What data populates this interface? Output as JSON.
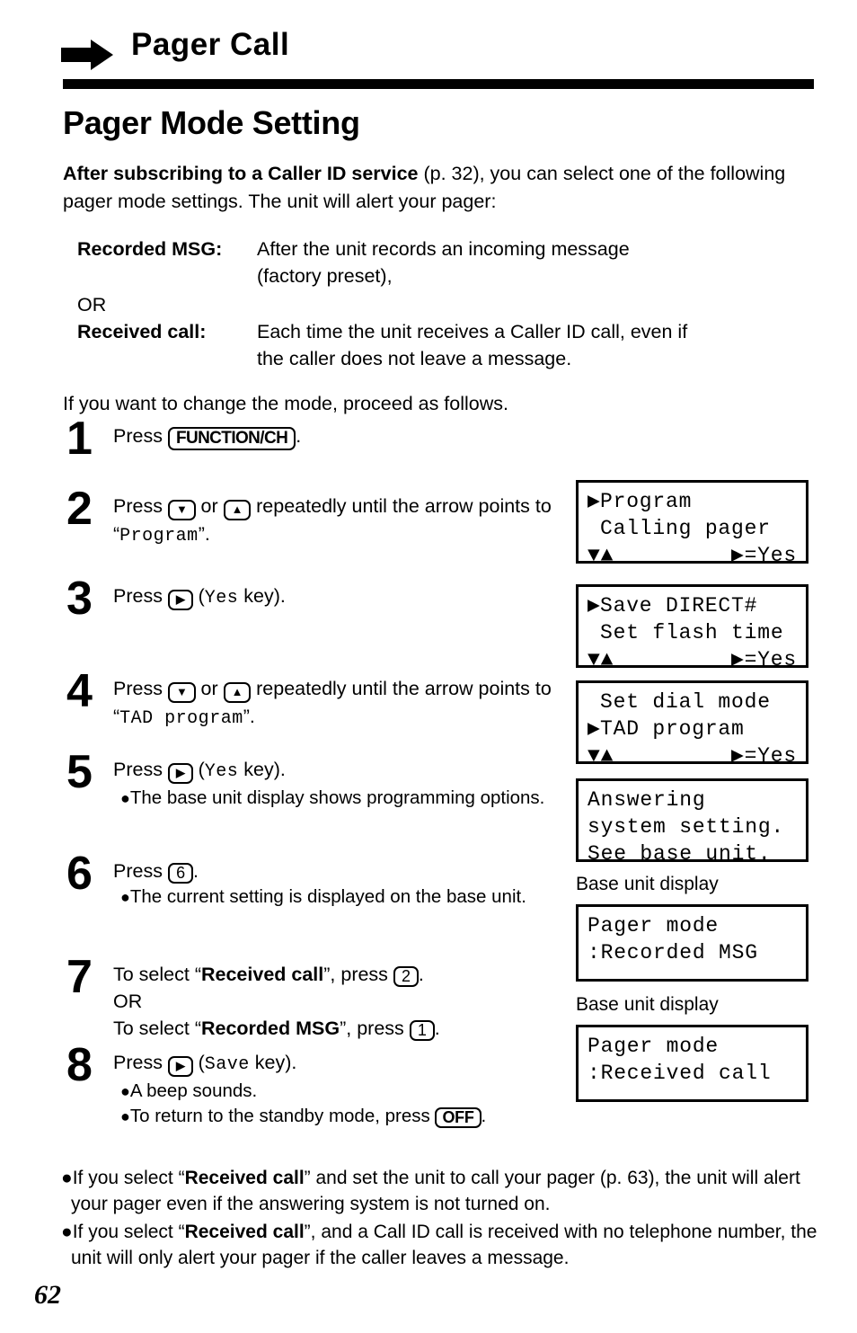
{
  "header": {
    "arrow_icon": "right-arrow-icon",
    "title": "Pager Call"
  },
  "section": {
    "title": "Pager Mode Setting",
    "intro_bold": "After subscribing to a Caller ID service",
    "intro_rest": " (p. 32), you can select one of the following pager mode settings. The unit will alert your pager:",
    "lead_in": "If you want to change the mode, proceed as follows."
  },
  "definitions": [
    {
      "term": "Recorded MSG:",
      "desc_line1": "After the unit records an incoming message",
      "desc_line2": "(factory preset),"
    },
    {
      "separator": "OR"
    },
    {
      "term": "Received call:",
      "desc_line1": "Each time the unit receives a Caller ID call, even if",
      "desc_line2": "the caller does not leave a message."
    }
  ],
  "steps": [
    {
      "number": "1",
      "press_label": "Press ",
      "key": "FUNCTION/CH",
      "tail": "."
    },
    {
      "number": "2",
      "press_label": "Press ",
      "key_down": "▼",
      "or_label": " or ",
      "key_up": "▲",
      "text_after": " repeatedly until the arrow points to “",
      "mono_value": "Program",
      "text_end": "”."
    },
    {
      "number": "3",
      "press_label": "Press ",
      "key_right": "▶",
      "paren_open": " (",
      "mono_value": "Yes",
      "paren_rest": " key)."
    },
    {
      "number": "4",
      "press_label": "Press ",
      "key_down": "▼",
      "or_label": " or ",
      "key_up": "▲",
      "text_after": " repeatedly until the arrow points to “",
      "mono_value": "TAD program",
      "text_end": "”."
    },
    {
      "number": "5",
      "press_label": "Press ",
      "key_right": "▶",
      "paren_open": " (",
      "mono_value": "Yes",
      "paren_rest": " key).",
      "notes": [
        "The base unit display shows programming options."
      ]
    },
    {
      "number": "6",
      "press_label": "Press ",
      "key_num": "6",
      "tail": ".",
      "notes": [
        "The current setting is displayed on the base unit."
      ]
    },
    {
      "number": "7",
      "line1_pre": "To select “",
      "line1_bold": "Received call",
      "line1_mid": "”, press ",
      "line1_key": "2",
      "line1_end": ".",
      "or_line": "OR",
      "line2_pre": "To select “",
      "line2_bold": "Recorded MSG",
      "line2_mid": "”, press ",
      "line2_key": "1",
      "line2_end": "."
    },
    {
      "number": "8",
      "press_label": "Press ",
      "key_right": "▶",
      "paren_open": " (",
      "mono_value": "Save",
      "paren_rest": " key).",
      "notes": [
        "A beep sounds."
      ],
      "note2_pre": "To return to the standby mode, press ",
      "note2_key": "OFF",
      "note2_end": "."
    }
  ],
  "displays": [
    {
      "id": "display-program",
      "line1": "Program",
      "line1_pointer": true,
      "line2": "Calling pager",
      "line2_pointer": false,
      "foot_left": "▼▲",
      "foot_right": "▶=Yes"
    },
    {
      "id": "display-save-direct",
      "line1": "Save DIRECT#",
      "line1_pointer": true,
      "line2": "Set flash time",
      "line2_pointer": false,
      "foot_left": "▼▲",
      "foot_right": "▶=Yes"
    },
    {
      "id": "display-tad-program",
      "line1": "Set dial mode",
      "line1_pointer": false,
      "line2": "TAD program",
      "line2_pointer": true,
      "foot_left": "▼▲",
      "foot_right": "▶=Yes"
    },
    {
      "id": "display-answering-system",
      "line1": "Answering",
      "line2": "system setting.",
      "line3": "See base unit."
    },
    {
      "id": "display-pager-mode-recorded",
      "caption": "Base unit display",
      "line1": "Pager mode",
      "line2": ":Recorded MSG"
    },
    {
      "id": "display-pager-mode-received",
      "caption": "Base unit display",
      "line1": "Pager mode",
      "line2": ":Received call"
    }
  ],
  "footnotes": [
    {
      "pre": "If you select “",
      "bold": "Received call",
      "post": "” and set the unit to call your pager (p. 63), the unit will alert your pager even if the answering system is not turned on."
    },
    {
      "pre": "If you select “",
      "bold": "Received call",
      "post": "”, and a Call ID call is received with no telephone number, the unit will only alert your pager if the caller leaves a message."
    }
  ],
  "page_number": "62"
}
